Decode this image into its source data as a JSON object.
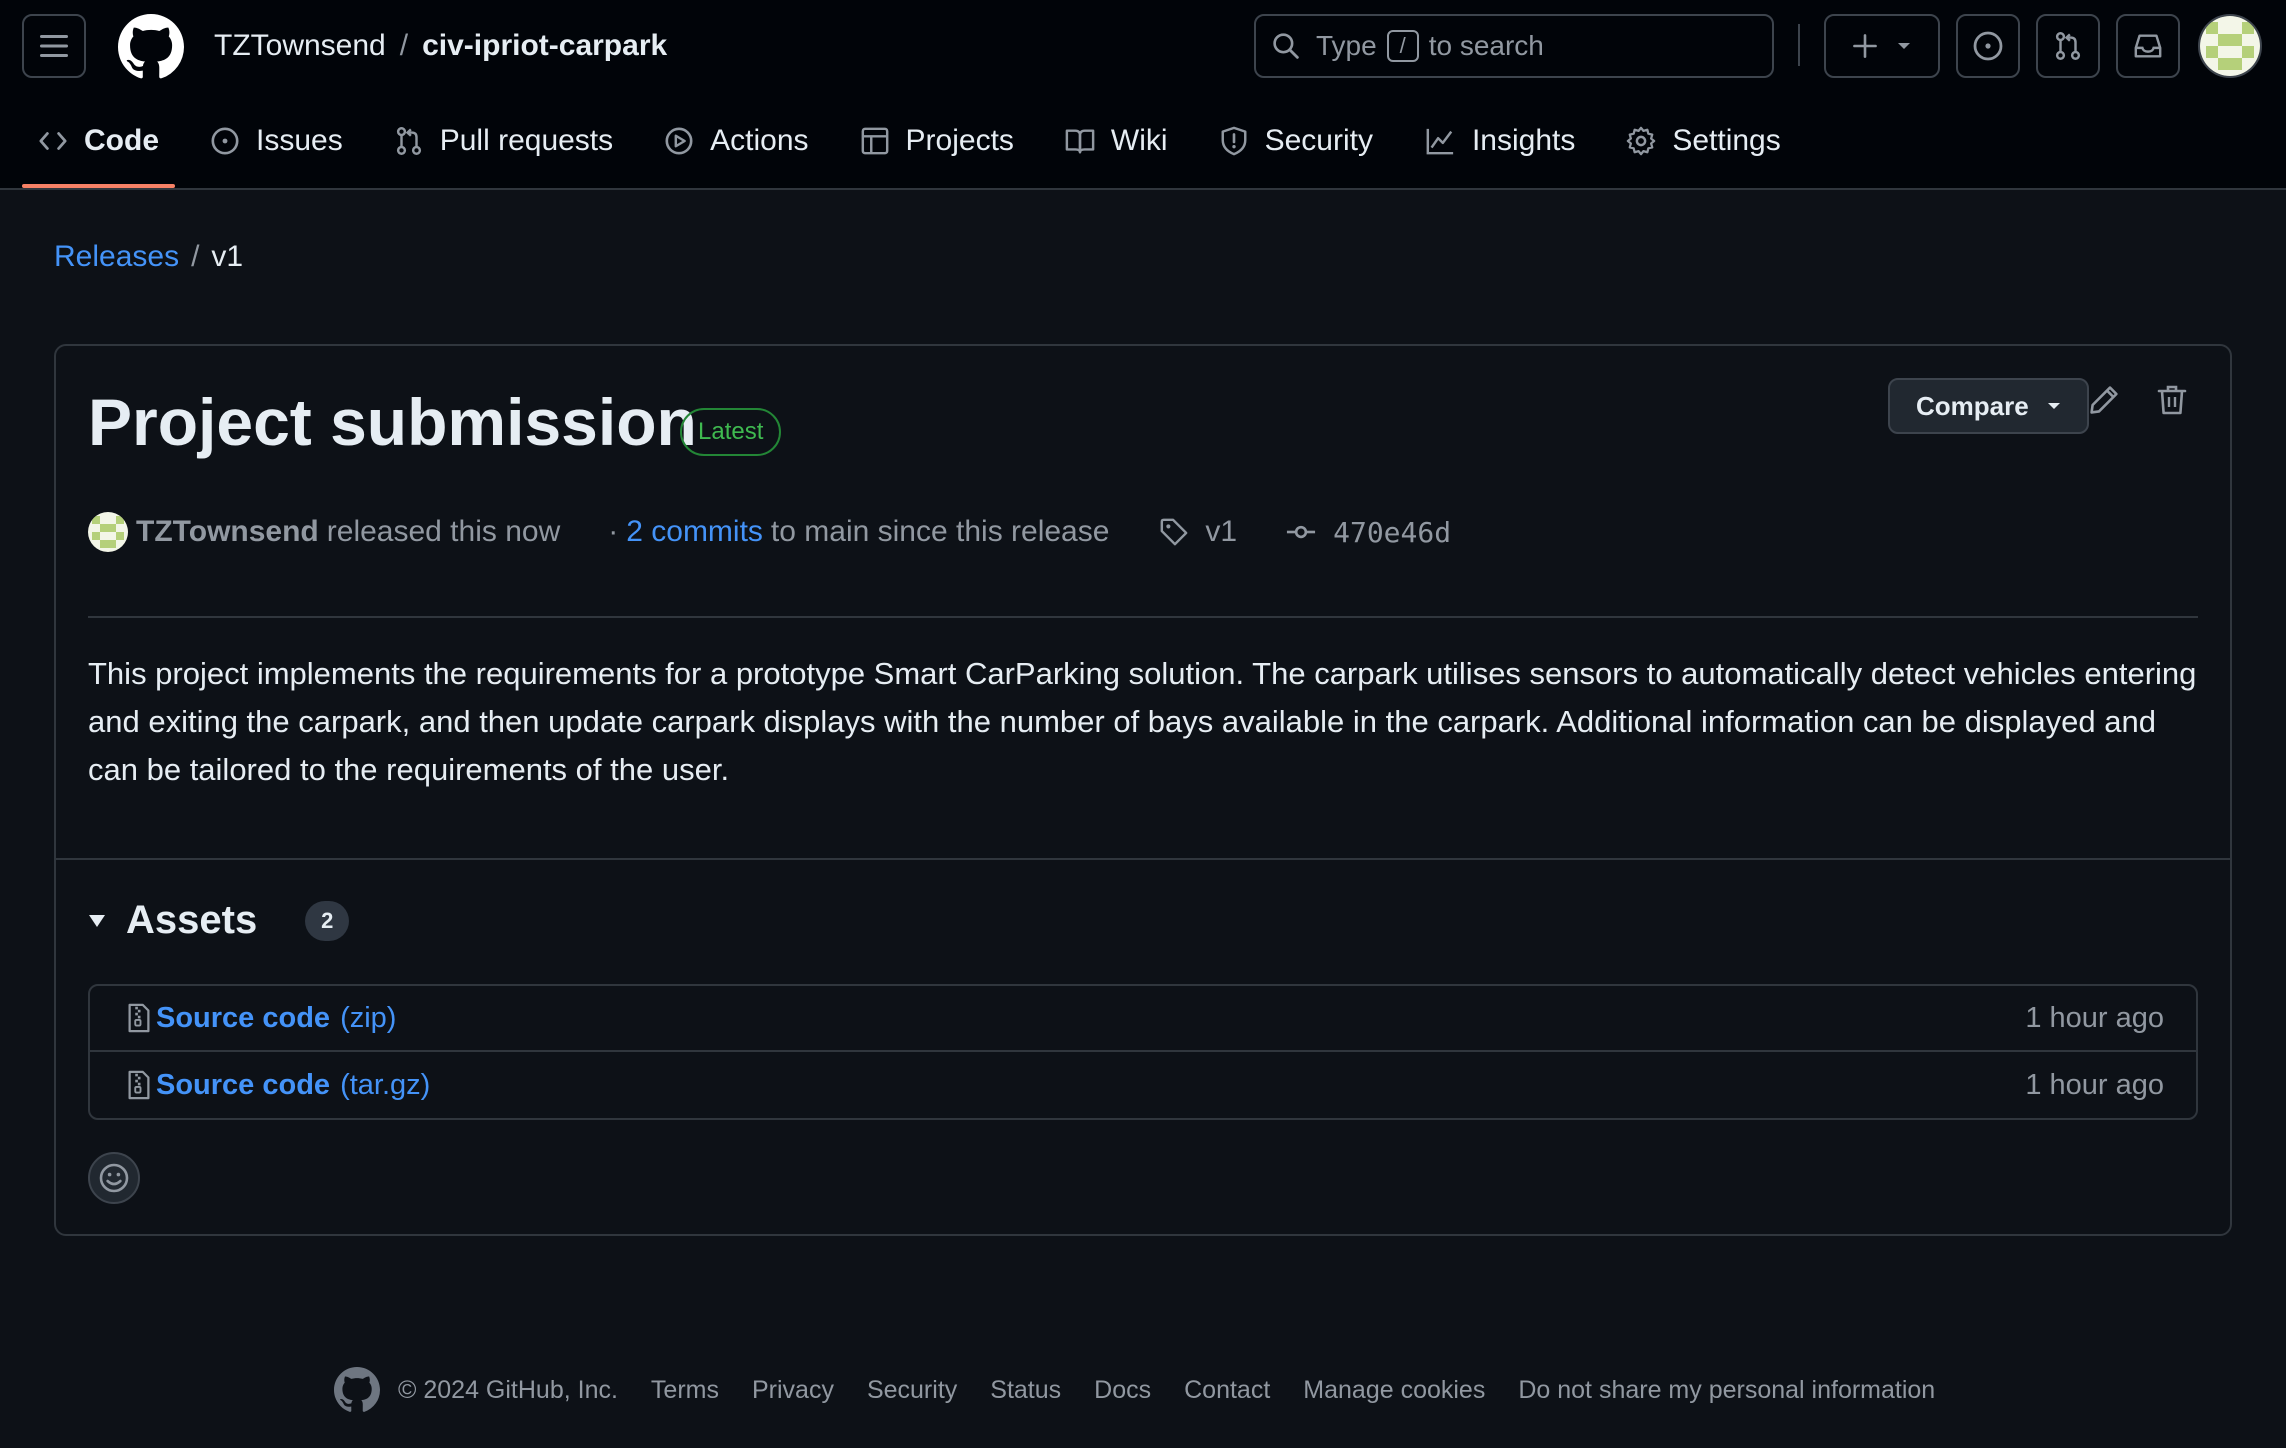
{
  "header": {
    "owner": "TZTownsend",
    "separator": "/",
    "repo": "civ-ipriot-carpark",
    "search": {
      "prefix": "Type",
      "key": "/",
      "suffix": "to search"
    }
  },
  "nav": [
    {
      "label": "Code",
      "icon": "code-icon",
      "active": true
    },
    {
      "label": "Issues",
      "icon": "issue-icon"
    },
    {
      "label": "Pull requests",
      "icon": "pull-request-icon"
    },
    {
      "label": "Actions",
      "icon": "play-icon"
    },
    {
      "label": "Projects",
      "icon": "table-icon"
    },
    {
      "label": "Wiki",
      "icon": "book-icon"
    },
    {
      "label": "Security",
      "icon": "shield-icon"
    },
    {
      "label": "Insights",
      "icon": "graph-icon"
    },
    {
      "label": "Settings",
      "icon": "gear-icon"
    }
  ],
  "breadcrumb": {
    "parent": "Releases",
    "separator": "/",
    "current": "v1"
  },
  "release": {
    "title": "Project submission",
    "badge": "Latest",
    "compare_label": "Compare",
    "author": "TZTownsend",
    "released_text": "released this now",
    "commits_dot": "·",
    "commits_link": "2 commits",
    "commits_rest": "to main since this release",
    "tag": "v1",
    "commit_sha": "470e46d",
    "description": "This project implements the requirements for a prototype Smart CarParking solution. The carpark utilises sensors to automatically detect vehicles entering and exiting the carpark, and then update carpark displays with the number of bays available in the carpark. Additional information can be displayed and can be tailored to the requirements of the user."
  },
  "assets": {
    "title": "Assets",
    "count": "2",
    "items": [
      {
        "name": "Source code",
        "ext": "(zip)",
        "time": "1 hour ago"
      },
      {
        "name": "Source code",
        "ext": "(tar.gz)",
        "time": "1 hour ago"
      }
    ]
  },
  "footer": {
    "copyright": "© 2024 GitHub, Inc.",
    "links": [
      "Terms",
      "Privacy",
      "Security",
      "Status",
      "Docs",
      "Contact",
      "Manage cookies",
      "Do not share my personal information"
    ]
  },
  "colors": {
    "background": "#0d1117",
    "header": "#010409",
    "link": "#4493f8",
    "active_tab": "#f78166",
    "latest_badge": "#3fb950"
  }
}
